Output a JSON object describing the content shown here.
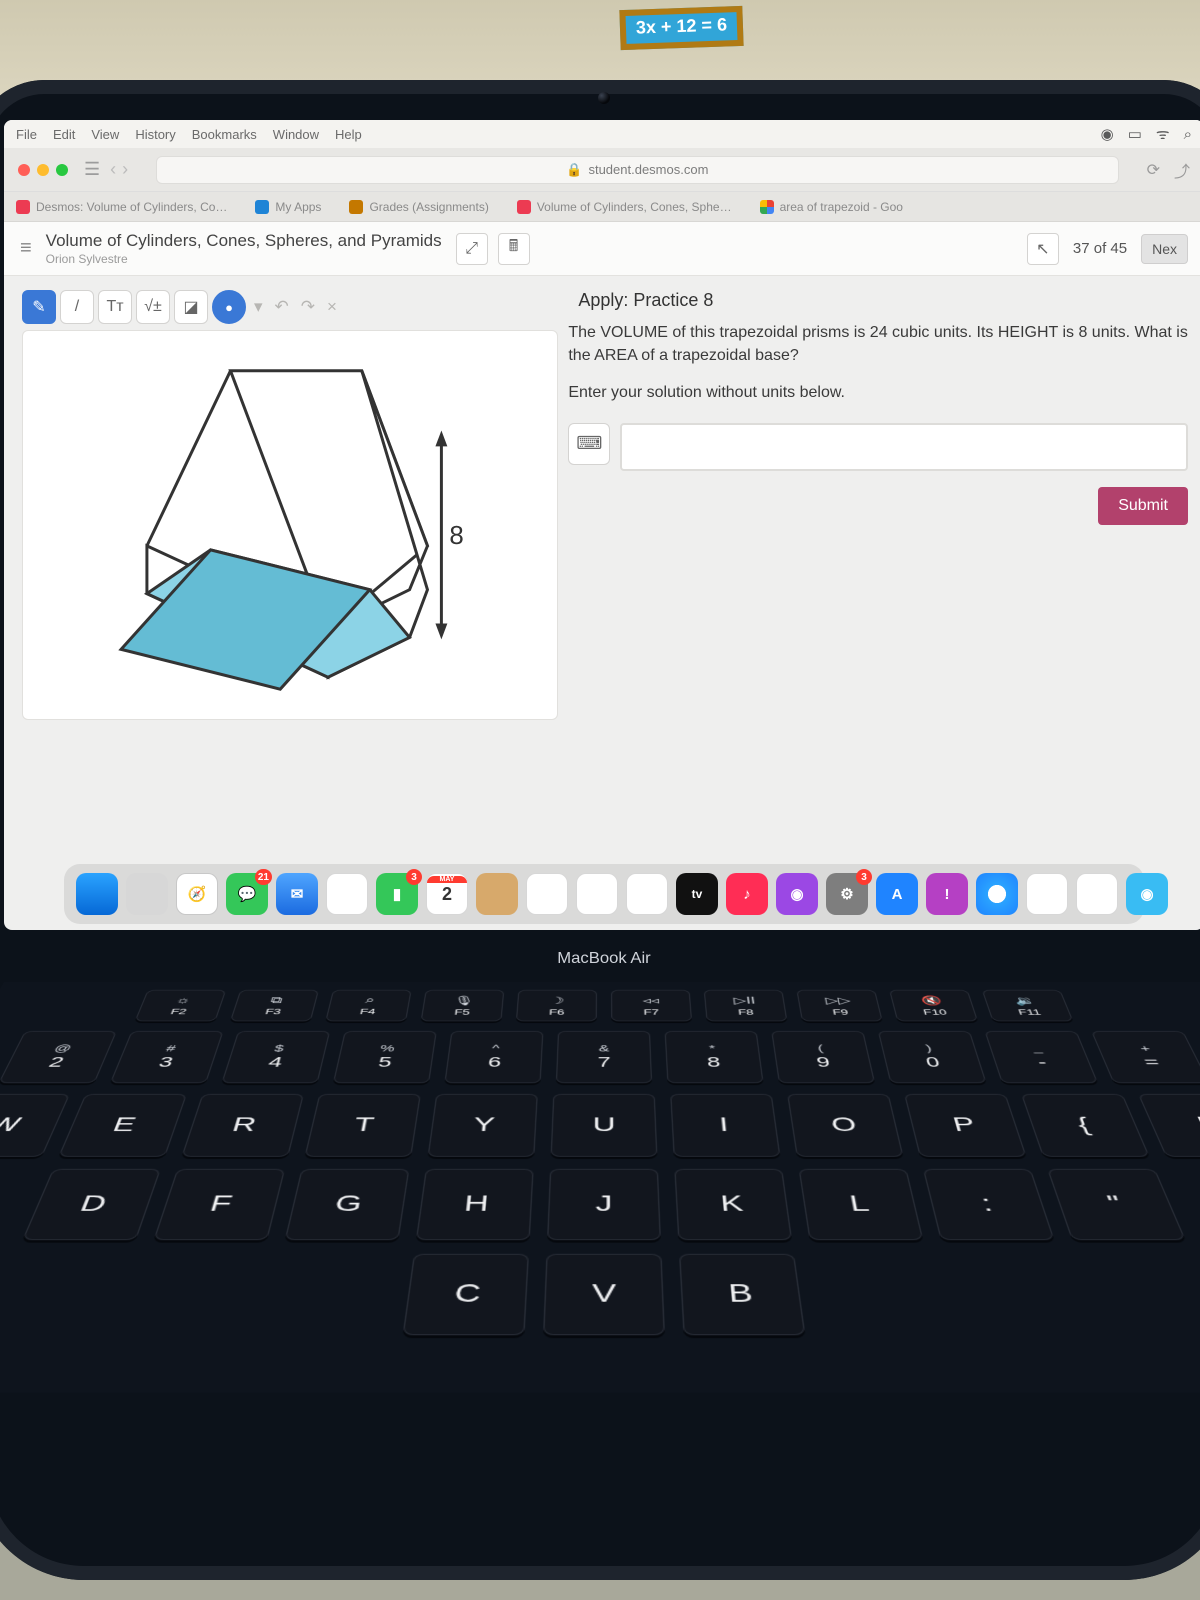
{
  "wall": {
    "equation": "3x + 12 = 6"
  },
  "menubar": {
    "items": [
      "File",
      "Edit",
      "View",
      "History",
      "Bookmarks",
      "Window",
      "Help"
    ]
  },
  "browser": {
    "url": "student.desmos.com",
    "tabs": [
      {
        "label": "Desmos: Volume of Cylinders, Co…"
      },
      {
        "label": "My Apps"
      },
      {
        "label": "Grades (Assignments)"
      },
      {
        "label": "Volume of Cylinders, Cones, Sphe…"
      },
      {
        "label": "area of trapezoid - Goo"
      }
    ]
  },
  "activity": {
    "title": "Volume of Cylinders, Cones, Spheres, and Pyramids",
    "student": "Orion Sylvestre",
    "section": "Apply: Practice 8",
    "progress": "37 of 45",
    "next": "Nex"
  },
  "tools": {
    "pen": "✎",
    "line": "/",
    "text": "Tᴛ",
    "math": "√±",
    "eraser": "◪",
    "color": "●",
    "undo": "↶",
    "redo": "↷",
    "clear": "×"
  },
  "figure": {
    "height_label": "8"
  },
  "problem": {
    "text": "The VOLUME of this trapezoidal prisms is 24 cubic units. Its HEIGHT is 8 units. What is the AREA of a trapezoidal base?",
    "hint": "Enter your solution without units below.",
    "keypad": "⌨",
    "submit": "Submit"
  },
  "dock": {
    "cal_month": "MAY",
    "cal_day": "2",
    "tv": "tv",
    "badges": {
      "msg": "21",
      "ft": "3",
      "sys": "3"
    }
  },
  "laptop_label": "MacBook Air",
  "keyboard": {
    "fn": [
      {
        "icon": "☼",
        "label": "F2"
      },
      {
        "icon": "⧉",
        "label": "F3"
      },
      {
        "icon": "⌕",
        "label": "F4"
      },
      {
        "icon": "🎙︎",
        "label": "F5"
      },
      {
        "icon": "☽",
        "label": "F6"
      },
      {
        "icon": "◃◃",
        "label": "F7"
      },
      {
        "icon": "▷II",
        "label": "F8"
      },
      {
        "icon": "▷▷",
        "label": "F9"
      },
      {
        "icon": "🔇",
        "label": "F10"
      },
      {
        "icon": "🔉",
        "label": "F11"
      }
    ],
    "num": [
      {
        "sym": "@",
        "n": "2"
      },
      {
        "sym": "#",
        "n": "3"
      },
      {
        "sym": "$",
        "n": "4"
      },
      {
        "sym": "%",
        "n": "5"
      },
      {
        "sym": "^",
        "n": "6"
      },
      {
        "sym": "&",
        "n": "7"
      },
      {
        "sym": "*",
        "n": "8"
      },
      {
        "sym": "(",
        "n": "9"
      },
      {
        "sym": ")",
        "n": "0"
      },
      {
        "sym": "_",
        "n": "-"
      },
      {
        "sym": "+",
        "n": "="
      }
    ],
    "row_qwerty": [
      "W",
      "E",
      "R",
      "T",
      "Y",
      "U",
      "I",
      "O",
      "P",
      "{",
      "["
    ],
    "row_asdf": [
      "D",
      "F",
      "G",
      "H",
      "J",
      "K",
      "L",
      ":",
      "\""
    ],
    "row_zxcv": [
      "C",
      "V",
      "B"
    ]
  }
}
